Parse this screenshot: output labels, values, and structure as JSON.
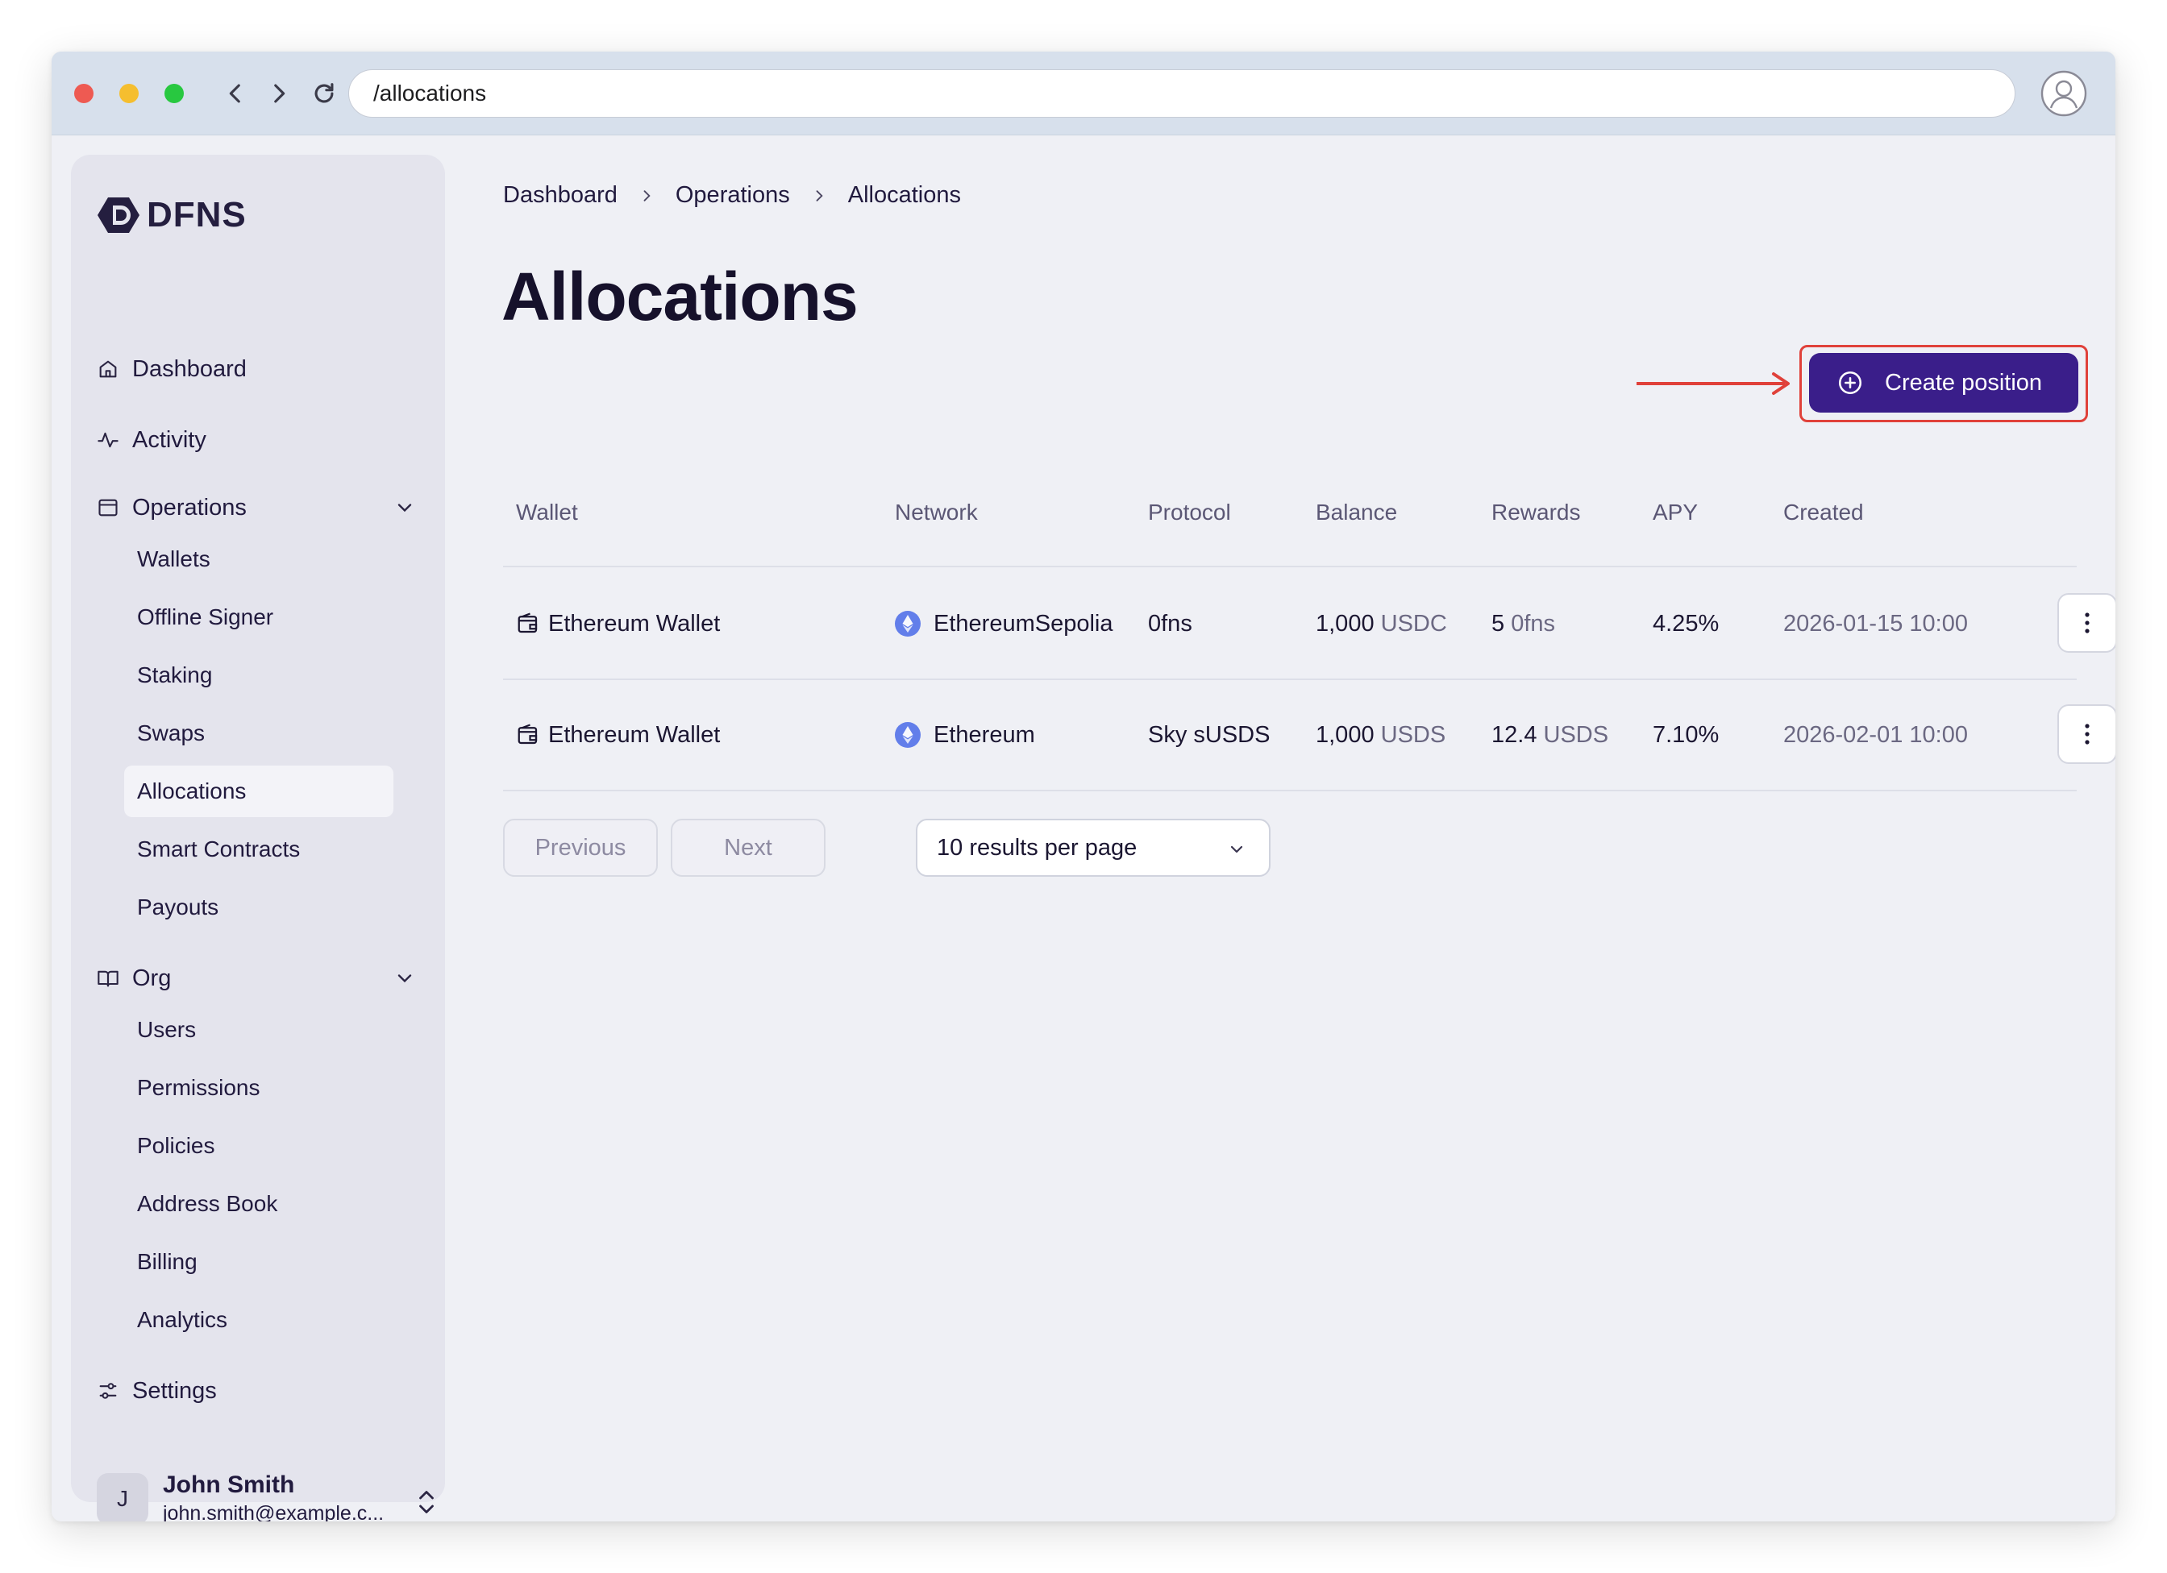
{
  "browser": {
    "url": "/allocations"
  },
  "brand": {
    "name": "DFNS"
  },
  "sidebar": {
    "items": [
      {
        "label": "Dashboard"
      },
      {
        "label": "Activity"
      },
      {
        "label": "Operations"
      },
      {
        "label": "Org"
      },
      {
        "label": "Settings"
      }
    ],
    "operations_sub": [
      {
        "label": "Wallets"
      },
      {
        "label": "Offline Signer"
      },
      {
        "label": "Staking"
      },
      {
        "label": "Swaps"
      },
      {
        "label": "Allocations"
      },
      {
        "label": "Smart Contracts"
      },
      {
        "label": "Payouts"
      }
    ],
    "org_sub": [
      {
        "label": "Users"
      },
      {
        "label": "Permissions"
      },
      {
        "label": "Policies"
      },
      {
        "label": "Address Book"
      },
      {
        "label": "Billing"
      },
      {
        "label": "Analytics"
      }
    ],
    "user": {
      "initial": "J",
      "name": "John Smith",
      "email": "john.smith@example.c..."
    }
  },
  "breadcrumb": [
    "Dashboard",
    "Operations",
    "Allocations"
  ],
  "page": {
    "title": "Allocations",
    "create_label": "Create position"
  },
  "table": {
    "columns": [
      "Wallet",
      "Network",
      "Protocol",
      "Balance",
      "Rewards",
      "APY",
      "Created"
    ],
    "rows": [
      {
        "wallet": "Ethereum Wallet",
        "network": "EthereumSepolia",
        "protocol": "0fns",
        "balance_amount": "1,000",
        "balance_unit": "USDC",
        "rewards_amount": "5",
        "rewards_unit": "0fns",
        "apy": "4.25%",
        "created": "2026-01-15 10:00"
      },
      {
        "wallet": "Ethereum Wallet",
        "network": "Ethereum",
        "protocol": "Sky sUSDS",
        "balance_amount": "1,000",
        "balance_unit": "USDS",
        "rewards_amount": "12.4",
        "rewards_unit": "USDS",
        "apy": "7.10%",
        "created": "2026-02-01 10:00"
      }
    ]
  },
  "pagination": {
    "previous": "Previous",
    "next": "Next",
    "per_page": "10 results per page"
  },
  "colors": {
    "accent": "#3a1e8a",
    "highlight": "#e0413a",
    "eth": "#627eea"
  }
}
